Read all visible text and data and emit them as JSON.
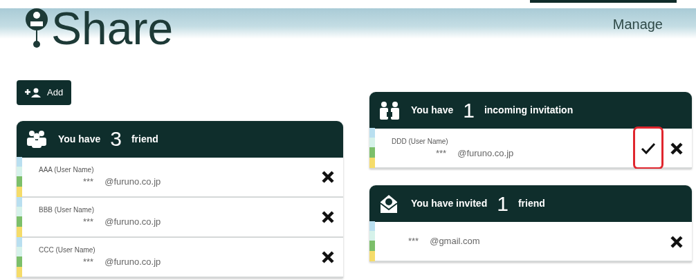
{
  "header": {
    "title": "Share",
    "tabs": [
      {
        "label": "Manage",
        "selected": true
      }
    ]
  },
  "add_button": {
    "label": "Add"
  },
  "friends": {
    "prefix": "You have",
    "count": "3",
    "suffix": "friend",
    "rows": [
      {
        "name": "AAA (User Name)",
        "mask": "***",
        "address": "@furuno.co.jp"
      },
      {
        "name": "BBB (User Name)",
        "mask": "***",
        "address": "@furuno.co.jp"
      },
      {
        "name": "CCC (User Name)",
        "mask": "***",
        "address": "@furuno.co.jp"
      }
    ]
  },
  "incoming": {
    "prefix": "You have",
    "count": "1",
    "suffix": "incoming invitation",
    "rows": [
      {
        "name": "DDD (User Name)",
        "mask": "***",
        "address": "@furuno.co.jp",
        "accept": true,
        "accept_highlighted": true
      }
    ]
  },
  "invited": {
    "prefix": "You have invited",
    "count": "1",
    "suffix": "friend",
    "rows": [
      {
        "mask": "***",
        "address": "@gmail.com"
      }
    ]
  }
}
